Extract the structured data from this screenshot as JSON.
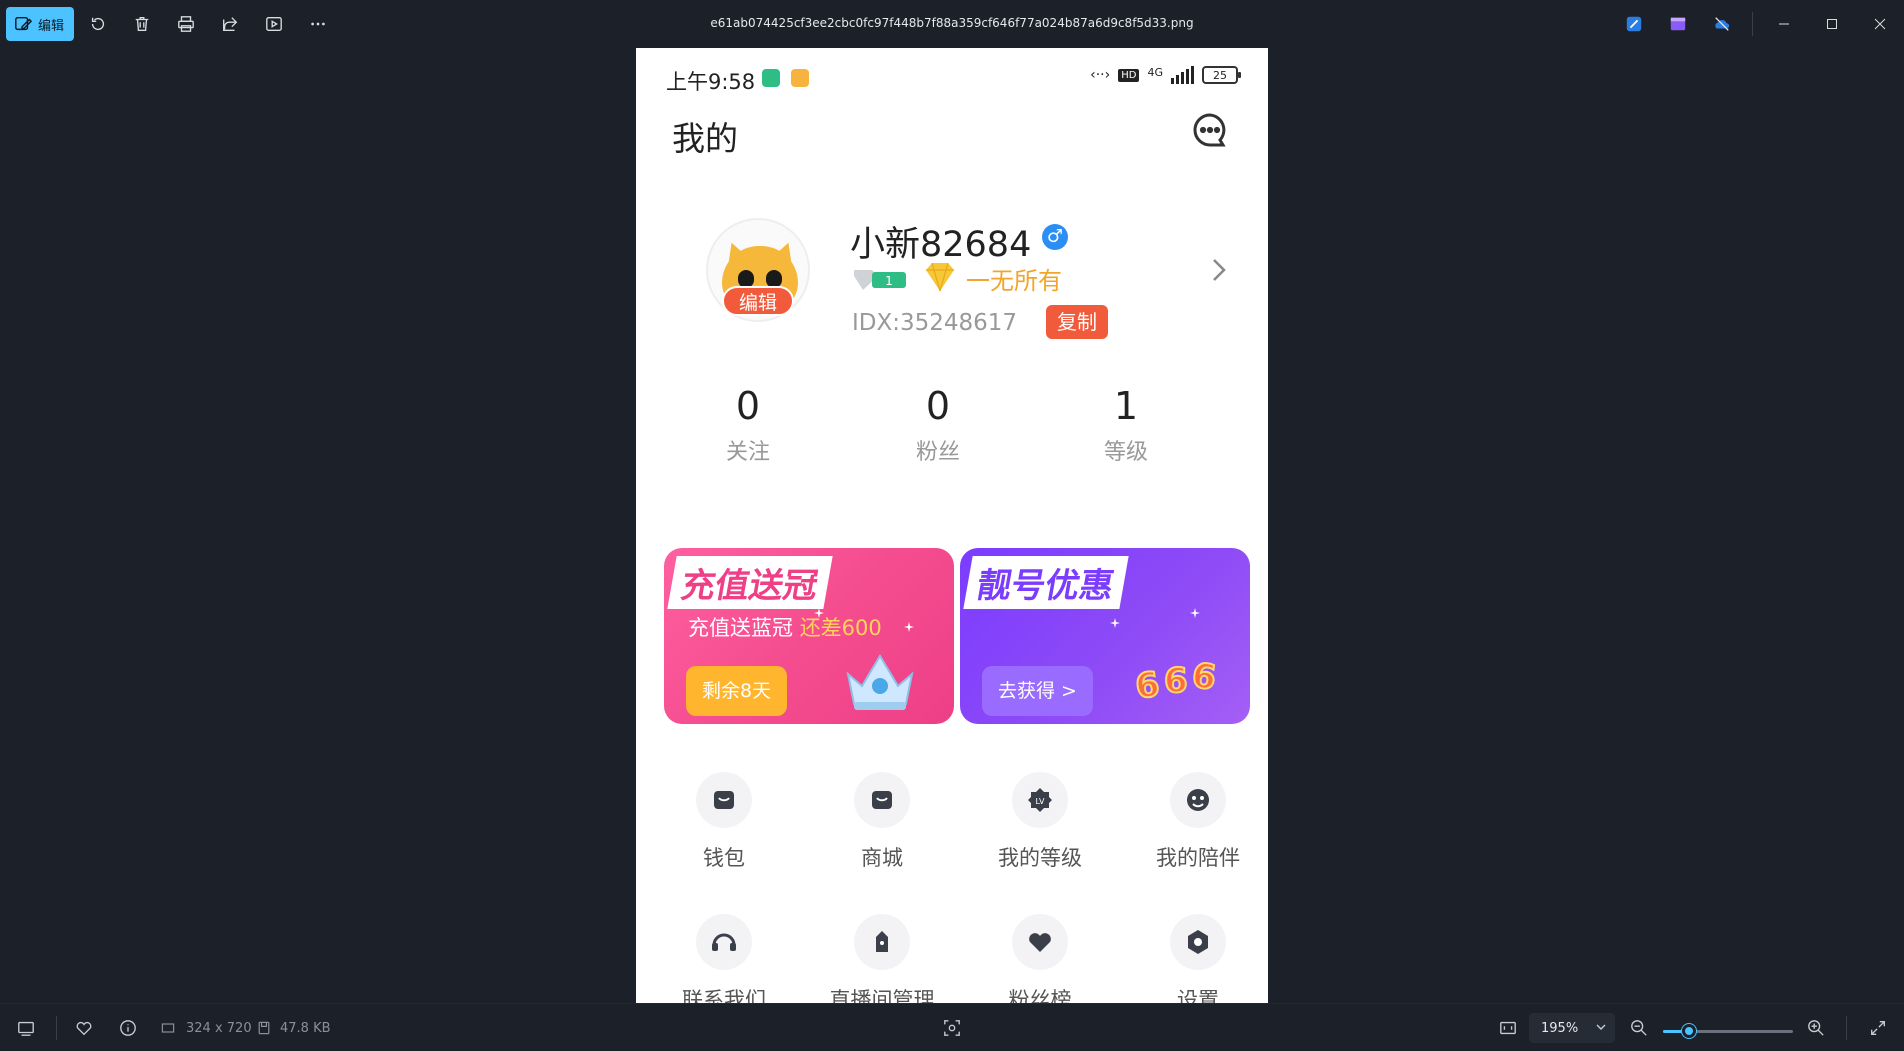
{
  "viewer": {
    "edit_label": "编辑",
    "file_name": "e61ab074425cf3ee2cbc0fc97f448b7f88a359cf646f77a024b87a6d9c8f5d33.png",
    "dimensions": "324 x 720",
    "file_size": "47.8 KB",
    "zoom_level": "195%",
    "zoom_fraction": 0.2,
    "accent_color": "#4cc2ff"
  },
  "phone": {
    "status": {
      "time": "上午9:58",
      "network": "4G",
      "battery": "25"
    },
    "page_title": "我的",
    "profile": {
      "username": "小新82684",
      "wealth_label": "一无所有",
      "idx": "IDX:35248617",
      "copy_label": "复制",
      "edit_label": "编辑"
    },
    "stats": [
      {
        "value": "0",
        "label": "关注"
      },
      {
        "value": "0",
        "label": "粉丝"
      },
      {
        "value": "1",
        "label": "等级"
      }
    ],
    "banners": [
      {
        "title": "充值送冠",
        "subtitle": "充值送蓝冠",
        "highlight": "还差600",
        "button": "剩余8天",
        "color": "#ee3f87"
      },
      {
        "title": "靓号优惠",
        "button": "去获得 >",
        "color": "#7b3cff"
      }
    ],
    "menu": [
      {
        "label": "钱包",
        "icon": "wallet-icon"
      },
      {
        "label": "商城",
        "icon": "shop-bag-icon"
      },
      {
        "label": "我的等级",
        "icon": "level-badge-icon"
      },
      {
        "label": "我的陪伴",
        "icon": "companion-face-icon"
      },
      {
        "label": "联系我们",
        "icon": "headset-icon"
      },
      {
        "label": "直播间管理",
        "icon": "lock-tag-icon"
      },
      {
        "label": "粉丝榜",
        "icon": "heart-icon"
      },
      {
        "label": "设置",
        "icon": "settings-hex-icon"
      }
    ]
  }
}
